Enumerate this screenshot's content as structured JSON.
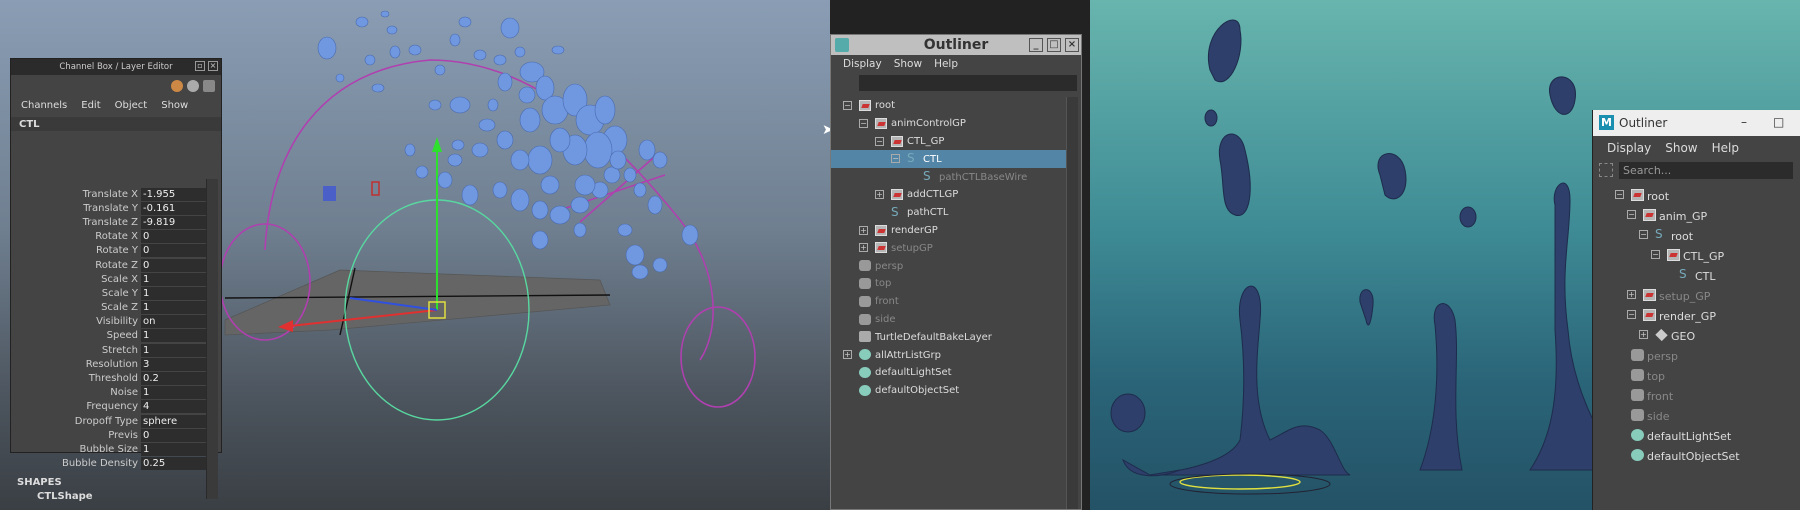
{
  "left_viewport": {
    "bg_top": "#8a9db4",
    "bg_bottom": "#3a3f44"
  },
  "channel_box": {
    "title": "Channel Box / Layer Editor",
    "menus": [
      "Channels",
      "Edit",
      "Object",
      "Show"
    ],
    "object": "CTL",
    "channels": [
      {
        "label": "Translate X",
        "value": "-1.955"
      },
      {
        "label": "Translate Y",
        "value": "-0.161"
      },
      {
        "label": "Translate Z",
        "value": "-9.819"
      },
      {
        "label": "Rotate X",
        "value": "0"
      },
      {
        "label": "Rotate Y",
        "value": "0"
      },
      {
        "label": "Rotate Z",
        "value": "0"
      },
      {
        "label": "Scale X",
        "value": "1"
      },
      {
        "label": "Scale Y",
        "value": "1"
      },
      {
        "label": "Scale Z",
        "value": "1"
      },
      {
        "label": "Visibility",
        "value": "on"
      },
      {
        "label": "Speed",
        "value": "1"
      },
      {
        "label": "Stretch",
        "value": "1"
      },
      {
        "label": "Resolution",
        "value": "3"
      },
      {
        "label": "Threshold",
        "value": "0.2"
      },
      {
        "label": "Noise",
        "value": "1"
      },
      {
        "label": "Frequency",
        "value": "4"
      },
      {
        "label": "Dropoff Type",
        "value": "sphere"
      },
      {
        "label": "Previs",
        "value": "0"
      },
      {
        "label": "Bubble Size",
        "value": "1"
      },
      {
        "label": "Bubble Density",
        "value": "0.25"
      }
    ],
    "shapes_header": "SHAPES",
    "shape_name": "CTLShape"
  },
  "outliner1": {
    "title": "Outliner",
    "menus": [
      "Display",
      "Show",
      "Help"
    ],
    "items": [
      {
        "label": "root",
        "depth": 0,
        "expander": "−",
        "icon": "group",
        "selected": false,
        "dim": false
      },
      {
        "label": "animControlGP",
        "depth": 1,
        "expander": "−",
        "icon": "group",
        "selected": false,
        "dim": false
      },
      {
        "label": "CTL_GP",
        "depth": 2,
        "expander": "−",
        "icon": "group",
        "selected": false,
        "dim": false
      },
      {
        "label": "CTL",
        "depth": 3,
        "expander": "−",
        "icon": "curve",
        "selected": true,
        "dim": false
      },
      {
        "label": "pathCTLBaseWire",
        "depth": 4,
        "expander": "",
        "icon": "curve",
        "selected": false,
        "dim": true
      },
      {
        "label": "addCTLGP",
        "depth": 2,
        "expander": "+",
        "icon": "group",
        "selected": false,
        "dim": false
      },
      {
        "label": "pathCTL",
        "depth": 2,
        "expander": "",
        "icon": "curve",
        "selected": false,
        "dim": false
      },
      {
        "label": "renderGP",
        "depth": 1,
        "expander": "+",
        "icon": "group",
        "selected": false,
        "dim": false
      },
      {
        "label": "setupGP",
        "depth": 1,
        "expander": "+",
        "icon": "group",
        "selected": false,
        "dim": true
      },
      {
        "label": "persp",
        "depth": 0,
        "expander": "",
        "icon": "camera",
        "selected": false,
        "dim": true
      },
      {
        "label": "top",
        "depth": 0,
        "expander": "",
        "icon": "camera",
        "selected": false,
        "dim": true
      },
      {
        "label": "front",
        "depth": 0,
        "expander": "",
        "icon": "camera",
        "selected": false,
        "dim": true
      },
      {
        "label": "side",
        "depth": 0,
        "expander": "",
        "icon": "camera",
        "selected": false,
        "dim": true
      },
      {
        "label": "TurtleDefaultBakeLayer",
        "depth": 0,
        "expander": "",
        "icon": "node",
        "selected": false,
        "dim": false
      },
      {
        "label": "allAttrListGrp",
        "depth": 0,
        "expander": "+",
        "icon": "set",
        "selected": false,
        "dim": false
      },
      {
        "label": "defaultLightSet",
        "depth": 0,
        "expander": "",
        "icon": "set",
        "selected": false,
        "dim": false
      },
      {
        "label": "defaultObjectSet",
        "depth": 0,
        "expander": "",
        "icon": "set",
        "selected": false,
        "dim": false
      }
    ]
  },
  "outliner2": {
    "title": "Outliner",
    "menus": [
      "Display",
      "Show",
      "Help"
    ],
    "search_placeholder": "Search...",
    "items": [
      {
        "label": "root",
        "depth": 0,
        "expander": "−",
        "icon": "group",
        "dim": false
      },
      {
        "label": "anim_GP",
        "depth": 1,
        "expander": "−",
        "icon": "group",
        "dim": false
      },
      {
        "label": "root",
        "depth": 2,
        "expander": "−",
        "icon": "curve",
        "dim": false
      },
      {
        "label": "CTL_GP",
        "depth": 3,
        "expander": "−",
        "icon": "group",
        "dim": false
      },
      {
        "label": "CTL",
        "depth": 4,
        "expander": "",
        "icon": "curve",
        "dim": false
      },
      {
        "label": "setup_GP",
        "depth": 1,
        "expander": "+",
        "icon": "group",
        "dim": true
      },
      {
        "label": "render_GP",
        "depth": 1,
        "expander": "−",
        "icon": "group",
        "dim": false
      },
      {
        "label": "GEO",
        "depth": 2,
        "expander": "+",
        "icon": "mesh",
        "dim": false
      },
      {
        "label": "persp",
        "depth": 0,
        "expander": "",
        "icon": "camera",
        "dim": true
      },
      {
        "label": "top",
        "depth": 0,
        "expander": "",
        "icon": "camera",
        "dim": true
      },
      {
        "label": "front",
        "depth": 0,
        "expander": "",
        "icon": "camera",
        "dim": true
      },
      {
        "label": "side",
        "depth": 0,
        "expander": "",
        "icon": "camera",
        "dim": true
      },
      {
        "label": "defaultLightSet",
        "depth": 0,
        "expander": "",
        "icon": "set",
        "dim": false
      },
      {
        "label": "defaultObjectSet",
        "depth": 0,
        "expander": "",
        "icon": "set",
        "dim": false
      }
    ]
  },
  "colors": {
    "selection": "#5285a6",
    "blob_blue": "#6f98e0",
    "rig_magenta": "#b040b0",
    "circle_green": "#58d8a0",
    "blob_navy": "#2d3f6a"
  }
}
